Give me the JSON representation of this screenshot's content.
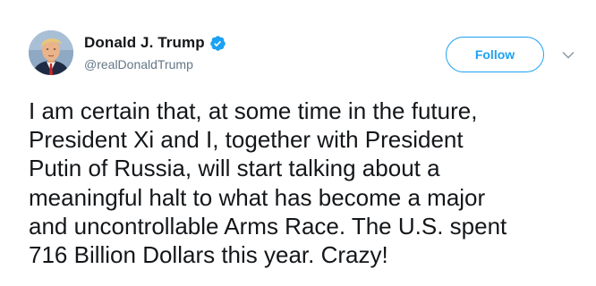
{
  "tweet": {
    "author": {
      "display_name": "Donald J. Trump",
      "handle": "@realDonaldTrump",
      "verified": true
    },
    "follow_label": "Follow",
    "text": "I am certain that, at some time in the future,\nPresident Xi and I, together with President\nPutin of Russia, will start talking about a\nmeaningful halt to what has become a major\nand uncontrollable Arms Race. The U.S. spent\n716 Billion Dollars this year. Crazy!"
  },
  "icons": {
    "avatar": "profile-photo",
    "verified": "verified-check-icon",
    "menu": "chevron-down-icon"
  },
  "colors": {
    "accent": "#1da1f2",
    "text": "#14171a",
    "secondary_text": "#657786"
  }
}
